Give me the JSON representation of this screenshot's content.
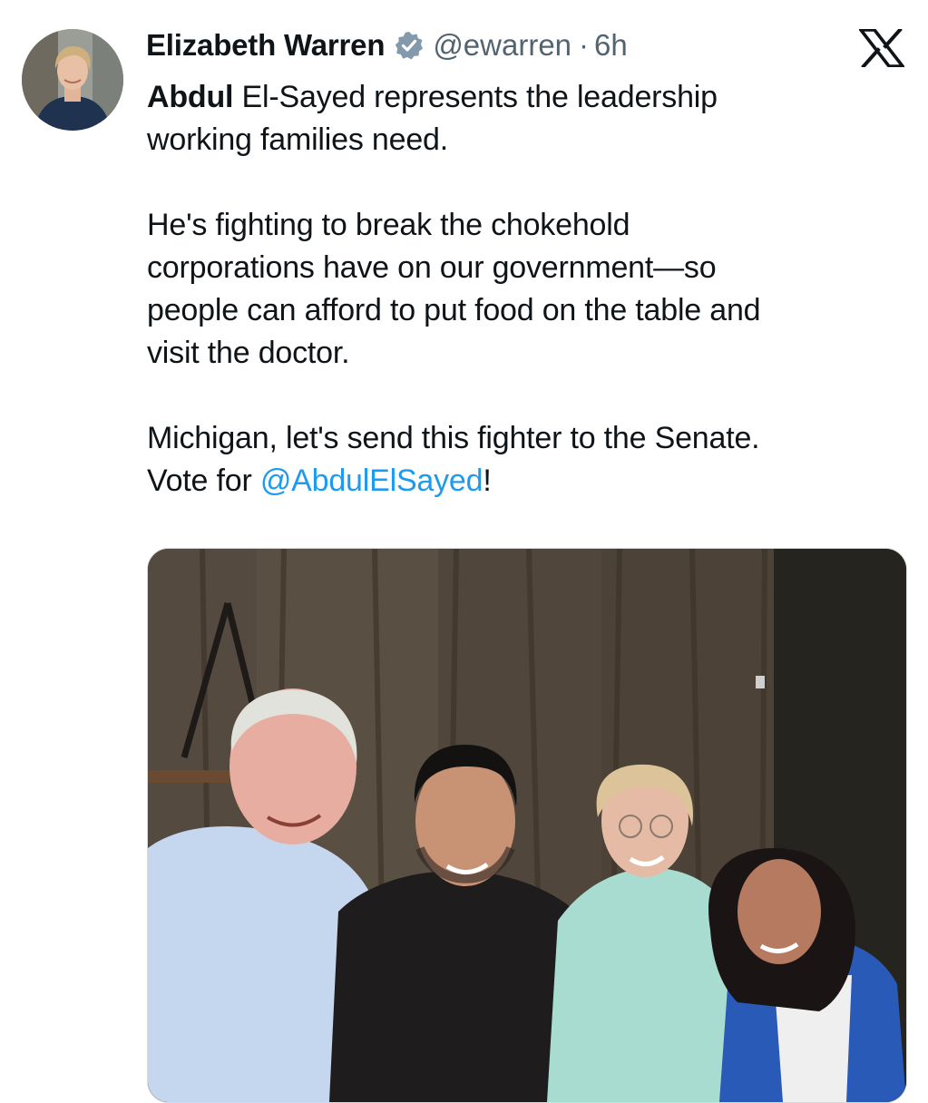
{
  "tweet": {
    "author_name": "Elizabeth Warren",
    "handle": "@ewarren",
    "separator": "·",
    "time": "6h",
    "text": {
      "line1_bold": "Abdul",
      "line1_rest": " El-Sayed represents the leadership",
      "line2": "working families need.",
      "para2_line1": "He's fighting to break the chokehold",
      "para2_line2": "corporations have on our government—so",
      "para2_line3": "people can afford to put food on the table and",
      "para2_line4": "visit the doctor.",
      "para3_line1": "Michigan, let's send this fighter to the Senate.",
      "para3_line2_prefix": "Vote for ",
      "mention": "@AbdulElSayed",
      "para3_line2_suffix": "!"
    }
  },
  "icons": {
    "verified": "verified-badge-icon",
    "platform": "x-logo-icon"
  },
  "colors": {
    "mention": "#1d9bf0",
    "handle": "#536471",
    "text": "#0f1419"
  }
}
